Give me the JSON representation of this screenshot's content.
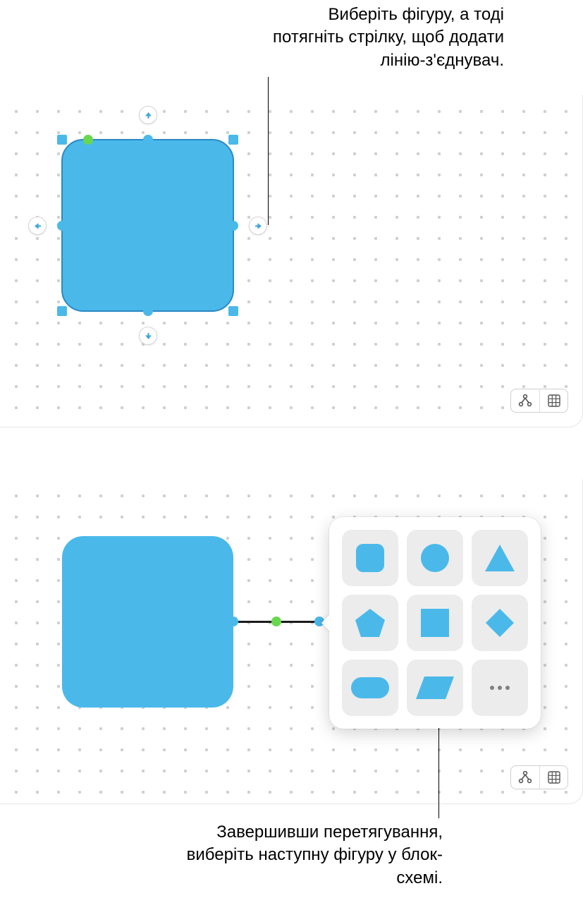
{
  "callouts": {
    "top": "Виберіть фігуру, а тоді потягніть стрілку, щоб додати лінію-з'єднувач.",
    "bottom": "Завершивши перетягування, виберіть наступну фігуру у блок-схемі."
  },
  "colors": {
    "shape_fill": "#4ab9ea",
    "handle_green": "#69d84f"
  },
  "picker_shapes": [
    "rounded-square",
    "circle",
    "triangle",
    "pentagon",
    "square",
    "diamond",
    "capsule",
    "parallelogram",
    "more"
  ],
  "toolbar_icons": [
    "connector-mode",
    "grid-toggle"
  ]
}
